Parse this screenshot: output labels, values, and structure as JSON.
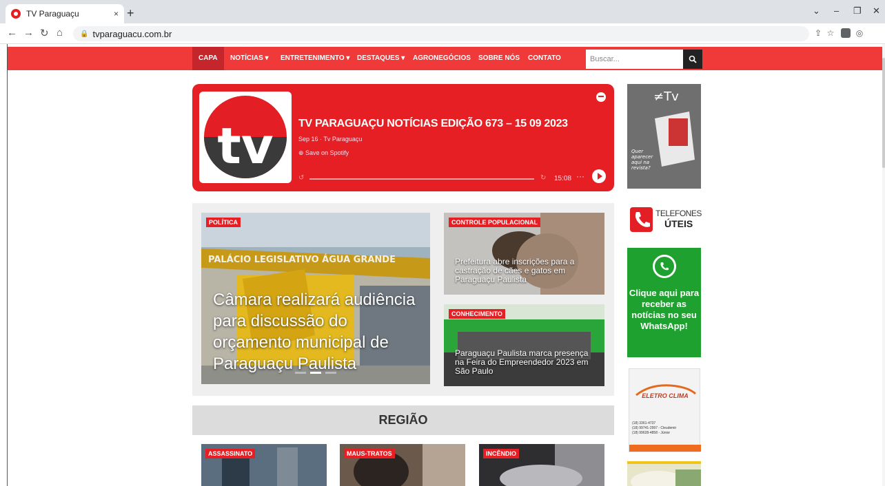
{
  "browser": {
    "tab_title": "TV Paraguaçu",
    "url": "tvparaguacu.com.br",
    "tab_close": "×",
    "new_tab": "+"
  },
  "nav": {
    "items": [
      "CAPA",
      "NOTÍCIAS ▾",
      "ENTRETENIMENTO ▾",
      "DESTAQUES ▾",
      "AGRONEGÓCIOS",
      "SOBRE NÓS",
      "CONTATO"
    ],
    "search_placeholder": "Buscar..."
  },
  "player": {
    "title": "TV PARAGUAÇU NOTÍCIAS EDIÇÃO 673 – 15 09 2023",
    "date": "Sep 16 · Tv Paraguaçu",
    "save": "⊕  Save on Spotify",
    "duration": "15:08",
    "more": "···"
  },
  "featured": {
    "main": {
      "category": "POLÍTICA",
      "title": "Câmara realizará audiência para discussão do orçamento municipal de Paraguaçu Paulista"
    },
    "side": [
      {
        "category": "CONTROLE POPULACIONAL",
        "title": "Prefeitura abre inscrições para a castração de cães e gatos em Paraguaçu Paulista"
      },
      {
        "category": "CONHECIMENTO",
        "title": "Paraguaçu Paulista marca presença na Feira do Empreendedor 2023 em São Paulo"
      }
    ]
  },
  "regiao": {
    "heading": "REGIÃO",
    "cards": [
      {
        "category": "ASSASSINATO"
      },
      {
        "category": "MAUS-TRATOS"
      },
      {
        "category": "INCÊNDIO"
      }
    ]
  },
  "sidebar": {
    "tel_line1": "TELEFONES",
    "tel_line2": "ÚTEIS",
    "whatsapp_text": "Clique aqui para receber as notícias no seu WhatsApp!",
    "eletro_name": "ELETRO CLIMA",
    "eletro_phones": "(18) 3361-4737\n(18) 99741-2997 - Cleudemir\n(18) 99628-4858 - Júnior"
  },
  "colors": {
    "brand_red": "#f03a3a",
    "player_red": "#e61f24",
    "whatsapp_green": "#1fa12f"
  }
}
